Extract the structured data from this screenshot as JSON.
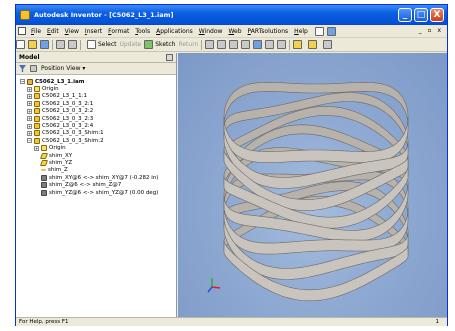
{
  "window": {
    "title": "Autodesk Inventor - [C5062_L3_1.iam]",
    "controls": [
      "_",
      "□",
      "X"
    ]
  },
  "menu": {
    "items": [
      "File",
      "Edit",
      "View",
      "Insert",
      "Format",
      "Tools",
      "Applications",
      "Window",
      "Web",
      "PARTsolutions",
      "Help"
    ],
    "right_controls": "_ ▫ x"
  },
  "toolbar": {
    "select_label": "Select",
    "update_label": "Update",
    "sketch_label": "Sketch",
    "return_label": "Return"
  },
  "panel": {
    "title": "Model",
    "view_label": "Position View",
    "tree": [
      {
        "label": "C5062_L3_1.iam",
        "icon": "assembly-icon",
        "depth": 0,
        "exp": "−",
        "root": true
      },
      {
        "label": "Origin",
        "icon": "folder-icon",
        "depth": 1,
        "exp": "+"
      },
      {
        "label": "C5062_L3_1_1:1",
        "icon": "part-icon",
        "depth": 1,
        "exp": "+"
      },
      {
        "label": "C5062_L3_0_3_2:1",
        "icon": "part-icon",
        "depth": 1,
        "exp": "+"
      },
      {
        "label": "C5062_L3_0_3_2:2",
        "icon": "part-icon",
        "depth": 1,
        "exp": "+"
      },
      {
        "label": "C5062_L3_0_3_2:3",
        "icon": "part-icon",
        "depth": 1,
        "exp": "+"
      },
      {
        "label": "C5062_L3_0_3_2:4",
        "icon": "part-icon",
        "depth": 1,
        "exp": "+"
      },
      {
        "label": "C5062_L3_0_3_Shim:1",
        "icon": "part-icon",
        "depth": 1,
        "exp": "+"
      },
      {
        "label": "C5062_L3_0_3_Shim:2",
        "icon": "part-icon",
        "depth": 1,
        "exp": "−"
      },
      {
        "label": "Origin",
        "icon": "folder-icon",
        "depth": 2,
        "exp": "+"
      },
      {
        "label": "shim_XY",
        "icon": "plane-icon",
        "depth": 2,
        "exp": ""
      },
      {
        "label": "shim_YZ",
        "icon": "plane-icon",
        "depth": 2,
        "exp": ""
      },
      {
        "label": "shim_Z",
        "icon": "axis-icon",
        "depth": 2,
        "exp": ""
      },
      {
        "label": "shim_XY@6 <-> shim_XY@7 (-0.282 in)",
        "icon": "constraint-icon",
        "depth": 2,
        "exp": ""
      },
      {
        "label": "shim_Z@6 <-> shim_Z@7",
        "icon": "constraint-icon",
        "depth": 2,
        "exp": ""
      },
      {
        "label": "shim_YZ@6 <-> shim_YZ@7 (0.00 deg)",
        "icon": "constraint-icon",
        "depth": 2,
        "exp": ""
      }
    ]
  },
  "status": {
    "text": "For Help, press F1",
    "number": "1"
  },
  "colors": {
    "viewport_bg": "#8ea9d2",
    "spring": "#c9c4bd",
    "spring_edge": "#6e6a66"
  }
}
